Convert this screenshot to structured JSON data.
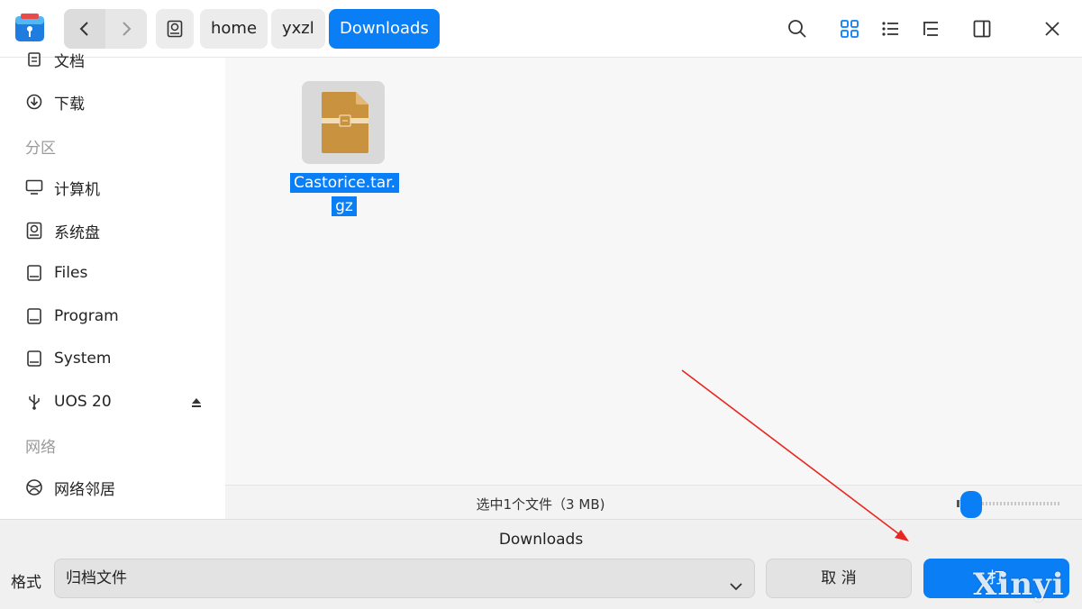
{
  "titlebar": {
    "nav_back_icon": "chevron-left-icon",
    "nav_forward_icon": "chevron-right-icon",
    "breadcrumb": [
      "home",
      "yxzl",
      "Downloads"
    ],
    "toolbar_icons": [
      "search-icon",
      "icon-view-icon",
      "list-view-icon",
      "tree-view-icon",
      "sidebar-toggle-icon",
      "close-icon"
    ]
  },
  "sidebar": {
    "items_top": [
      {
        "label": "文档",
        "icon": "document-icon"
      },
      {
        "label": "下载",
        "icon": "download-icon"
      }
    ],
    "section_partition": "分区",
    "partitions": [
      {
        "label": "计算机",
        "icon": "computer-icon"
      },
      {
        "label": "系统盘",
        "icon": "disk-icon"
      },
      {
        "label": "Files",
        "icon": "drive-icon"
      },
      {
        "label": "Program",
        "icon": "drive-icon"
      },
      {
        "label": "System",
        "icon": "drive-icon"
      },
      {
        "label": "UOS 20",
        "icon": "usb-icon"
      }
    ],
    "section_network": "网络",
    "network_items": [
      {
        "label": "网络邻居",
        "icon": "network-icon"
      }
    ]
  },
  "main": {
    "file": {
      "name_line1": "Castorice.tar.",
      "name_line2": "gz",
      "icon": "archive-icon"
    }
  },
  "status": {
    "text": "选中1个文件（3 MB)"
  },
  "bottom": {
    "dir_name": "Downloads",
    "format_label": "格式",
    "format_value": "归档文件",
    "cancel_label": "取 消",
    "save_label": "打",
    "watermark": "Xinyi"
  },
  "colors": {
    "accent": "#0a7ef5",
    "annotation_arrow": "#e8261f"
  }
}
